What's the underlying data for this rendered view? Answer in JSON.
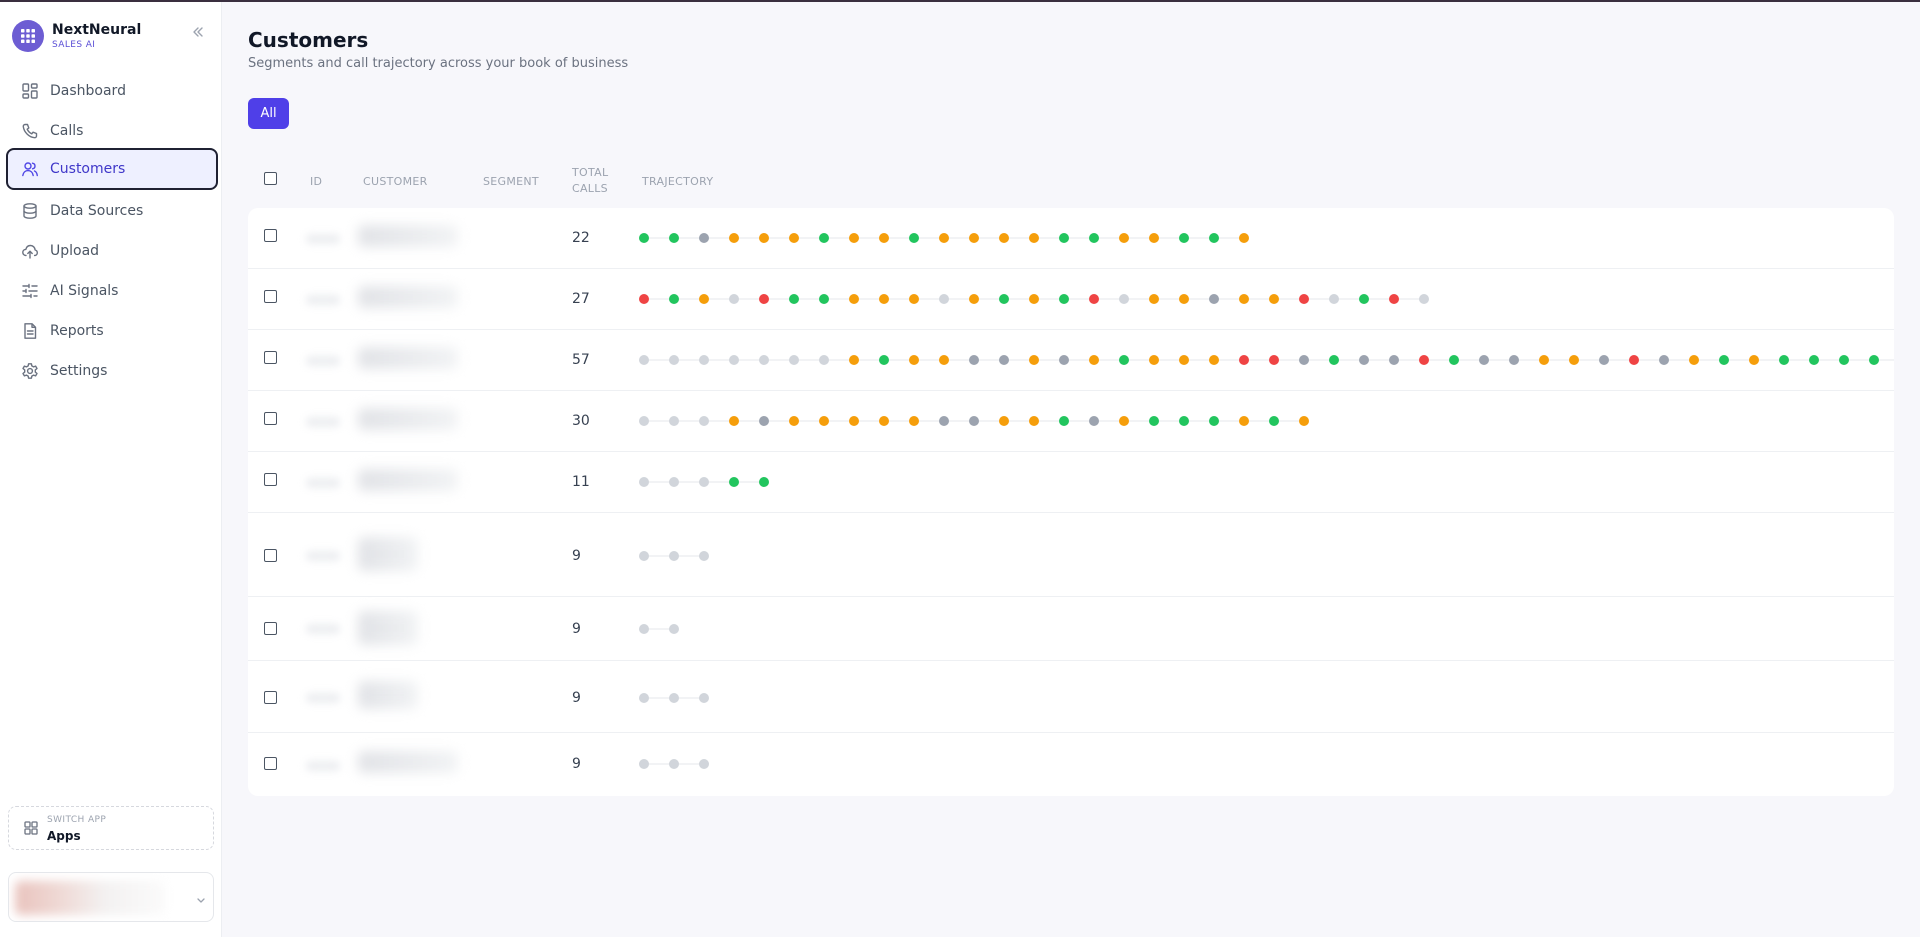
{
  "app": {
    "name": "NextNeural",
    "subtitle": "SALES AI"
  },
  "nav": [
    {
      "label": "Dashboard",
      "icon": "dashboard-icon",
      "active": false
    },
    {
      "label": "Calls",
      "icon": "phone-icon",
      "active": false
    },
    {
      "label": "Customers",
      "icon": "users-icon",
      "active": true
    },
    {
      "label": "Data Sources",
      "icon": "database-icon",
      "active": false
    },
    {
      "label": "Upload",
      "icon": "upload-cloud-icon",
      "active": false
    },
    {
      "label": "AI Signals",
      "icon": "sliders-icon",
      "active": false
    },
    {
      "label": "Reports",
      "icon": "document-icon",
      "active": false
    },
    {
      "label": "Settings",
      "icon": "gear-icon",
      "active": false
    }
  ],
  "switch_app": {
    "caption": "SWITCH APP",
    "label": "Apps"
  },
  "page": {
    "title": "Customers",
    "subtitle": "Segments and call trajectory across your book of business",
    "filter_all": "All"
  },
  "table": {
    "headers": {
      "id": "ID",
      "customer": "CUSTOMER",
      "segment": "SEGMENT",
      "total_calls_1": "TOTAL",
      "total_calls_2": "CALLS",
      "trajectory": "TRAJECTORY"
    },
    "rows": [
      {
        "total_calls": "22",
        "trajectory": "GGNOOOGOOGOOOOGGOOGGO"
      },
      {
        "total_calls": "27",
        "trajectory": "RGOLRGGOOOLOGOGRLOONOORLGRL"
      },
      {
        "total_calls": "57",
        "trajectory": "LLLLLLLOGOONNONOGOOORRNGNNRGNNOONRNOGOGGGGG"
      },
      {
        "total_calls": "30",
        "trajectory": "LLLONOOOOONNOOGNOGGGOGO"
      },
      {
        "total_calls": "11",
        "trajectory": "LLLGG"
      },
      {
        "total_calls": "9",
        "trajectory": "LLL"
      },
      {
        "total_calls": "9",
        "trajectory": "LL"
      },
      {
        "total_calls": "9",
        "trajectory": "LLL"
      },
      {
        "total_calls": "9",
        "trajectory": "LLL"
      }
    ]
  },
  "colors": {
    "accent": "#4f3fe8",
    "positive": "#22c55e",
    "neutral": "#f59e0b",
    "negative": "#ef4444",
    "muted": "#9ca3af",
    "empty": "#d1d5db",
    "faint": "#e5e7eb"
  }
}
